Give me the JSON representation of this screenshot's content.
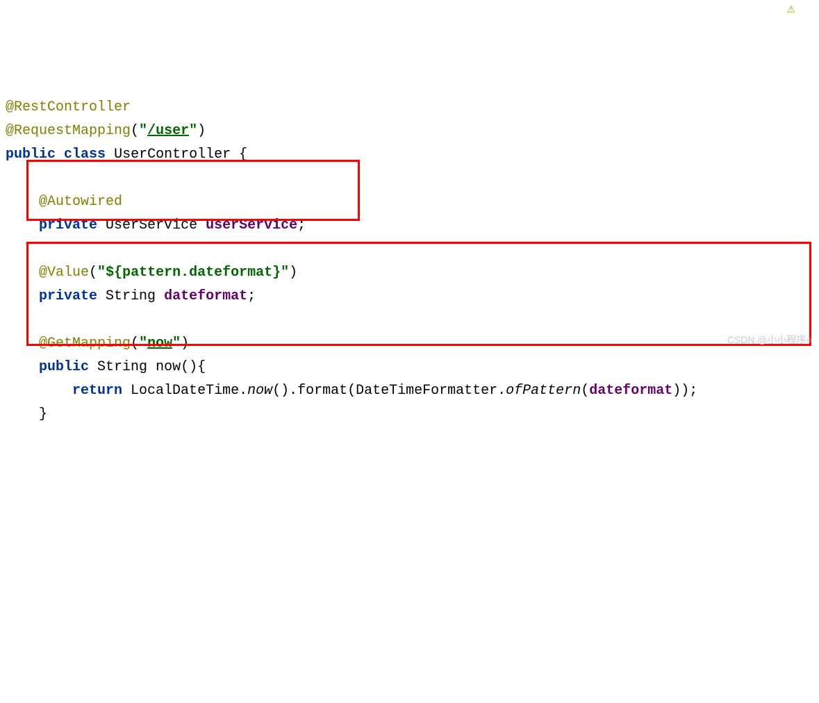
{
  "code": {
    "l1": {
      "anno": "@RestController"
    },
    "l2": {
      "anno": "@RequestMapping",
      "paren_open": "(",
      "q1": "\"",
      "path": "/user",
      "q2": "\"",
      "paren_close": ")"
    },
    "l3": {
      "kw1": "public",
      "kw2": "class",
      "name": "UserController",
      "brace": " {"
    },
    "l5": {
      "anno": "@Autowired"
    },
    "l6": {
      "kw": "private",
      "type": "UserService",
      "field": "userService",
      "semi": ";"
    },
    "l8": {
      "anno": "@Value",
      "paren_open": "(",
      "q1": "\"",
      "val": "${pattern.dateformat}",
      "q2": "\"",
      "paren_close": ")"
    },
    "l9": {
      "kw": "private",
      "type": "String",
      "field": "dateformat",
      "semi": ";"
    },
    "l11": {
      "anno": "@GetMapping",
      "paren_open": "(",
      "q1": "\"",
      "val": "now",
      "q2": "\"",
      "paren_close": ")"
    },
    "l12": {
      "kw": "public",
      "type": "String",
      "name": "now",
      "rest": "(){"
    },
    "l13": {
      "kw": "return",
      "cls1": "LocalDateTime",
      "dot1": ".",
      "m1": "now",
      "p1": "().format(DateTimeFormatter.",
      "m2": "ofPattern",
      "p2": "(",
      "field": "dateformat",
      "p3": "));"
    },
    "l14": {
      "brace": "}"
    }
  },
  "watermark": "CSDN @小小程序○"
}
